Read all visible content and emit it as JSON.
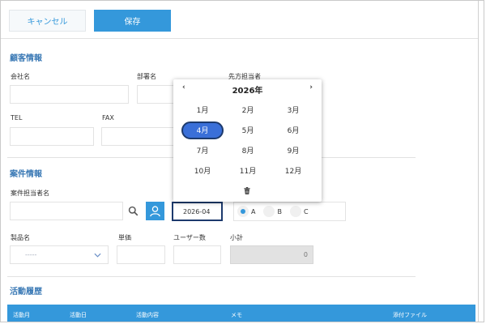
{
  "toolbar": {
    "cancel_label": "キャンセル",
    "save_label": "保存"
  },
  "customer": {
    "title": "顧客情報",
    "company_label": "会社名",
    "department_label": "部署名",
    "contact_label": "先方担当者",
    "tel_label": "TEL",
    "fax_label": "FAX"
  },
  "deal": {
    "title": "案件情報",
    "owner_label": "案件担当者名",
    "date_value": "2026-04",
    "radios": [
      {
        "label": "A",
        "checked": true
      },
      {
        "label": "B",
        "checked": false
      },
      {
        "label": "C",
        "checked": false
      }
    ],
    "product_label": "製品名",
    "product_select_value": "-----",
    "price_label": "単価",
    "users_label": "ユーザー数",
    "subtotal_label": "小計",
    "subtotal_value": "0"
  },
  "history": {
    "title": "活動履歴",
    "columns": [
      "活動月",
      "活動日",
      "活動内容",
      "メモ",
      "添付ファイル"
    ]
  },
  "calendar": {
    "prev": "‹",
    "next": "›",
    "year": "2026年",
    "months": [
      "1月",
      "2月",
      "3月",
      "4月",
      "5月",
      "6月",
      "7月",
      "8月",
      "9月",
      "10月",
      "11月",
      "12月"
    ],
    "selected_month": "4月"
  },
  "colors": {
    "accent": "#3498db",
    "section_title": "#3a79b5",
    "selected": "#3a6fd8"
  },
  "icons": {
    "search": "search-icon",
    "user": "user-icon",
    "trash": "trash-icon",
    "chevron": "chevron-down-icon"
  }
}
